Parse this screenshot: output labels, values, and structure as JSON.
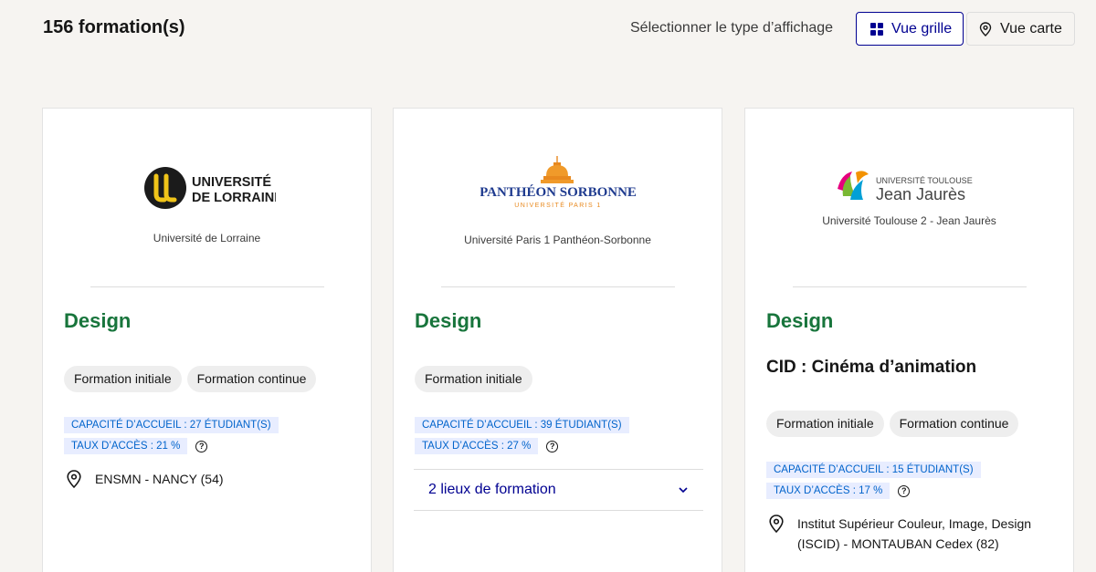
{
  "header": {
    "count": "156 formation(s)",
    "view_label": "Sélectionner le type d’affichage",
    "grid_button": "Vue grille",
    "map_button": "Vue carte"
  },
  "colors": {
    "accent_blue": "#000091",
    "title_green": "#18753c",
    "stat_text": "#0063cb",
    "stat_bg": "#e8edff"
  },
  "cards": [
    {
      "logo": {
        "line1": "UNIVERSITÉ",
        "line2": "DE LORRAINE"
      },
      "establishment": "Université de Lorraine",
      "title": "Design",
      "tags": [
        "Formation initiale",
        "Formation continue"
      ],
      "capacity": "CAPACITÉ D’ACCUEIL : 27 ÉTUDIANT(S)",
      "access_rate": "TAUX D’ACCÈS : 21 %",
      "location": "ENSMN - NANCY (54)"
    },
    {
      "logo": {
        "line1": "PANTHÉON SORBONNE",
        "line2": "UNIVERSITÉ PARIS 1"
      },
      "establishment": "Université Paris 1 Panthéon-Sorbonne",
      "title": "Design",
      "tags": [
        "Formation initiale"
      ],
      "capacity": "CAPACITÉ D’ACCUEIL : 39 ÉTUDIANT(S)",
      "access_rate": "TAUX D’ACCÈS : 27 %",
      "locations_toggle": "2 lieux de formation"
    },
    {
      "logo": {
        "line1": "UNIVERSITÉ TOULOUSE",
        "line2": "Jean Jaurès"
      },
      "establishment": "Université Toulouse 2 - Jean Jaurès",
      "title": "Design",
      "subtitle": "CID : Cinéma d’animation",
      "tags": [
        "Formation initiale",
        "Formation continue"
      ],
      "capacity": "CAPACITÉ D’ACCUEIL : 15 ÉTUDIANT(S)",
      "access_rate": "TAUX D’ACCÈS : 17 %",
      "location_line1": "Institut Supérieur Couleur, Image, Design",
      "location_line2": "(ISCID) - MONTAUBAN Cedex (82)"
    }
  ]
}
